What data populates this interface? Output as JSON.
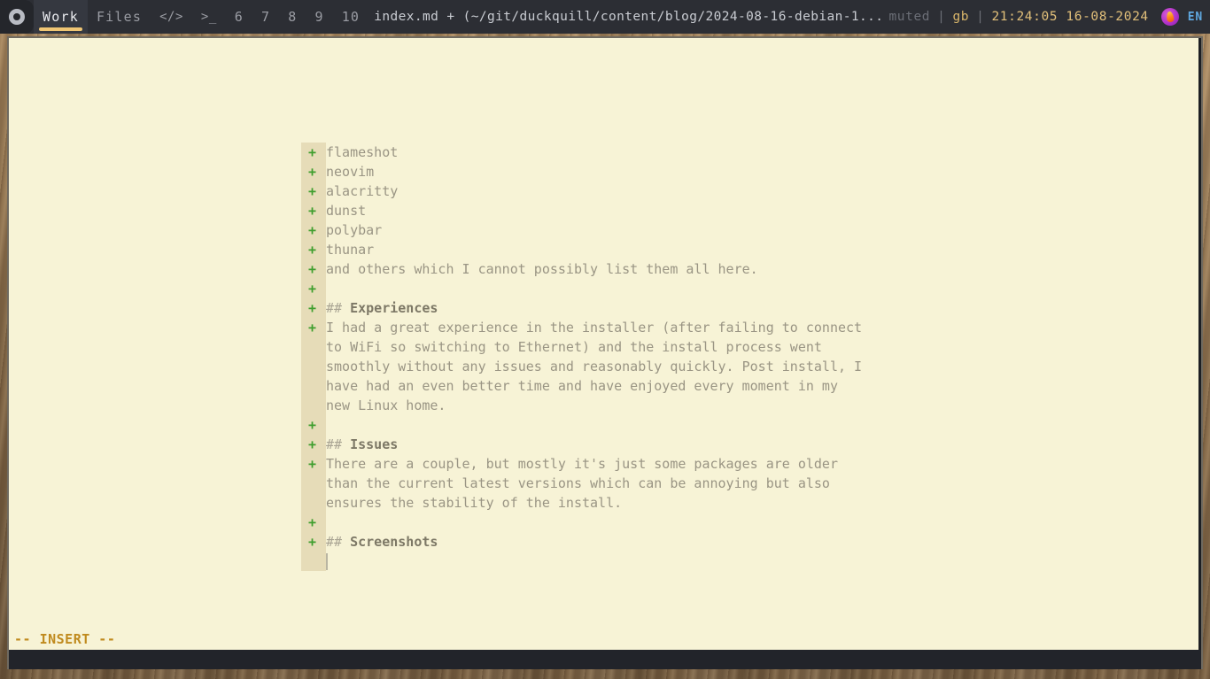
{
  "polybar": {
    "launcher_icon": "chromium-icon",
    "workspaces": [
      {
        "label": "Work",
        "active": true,
        "name": "workspace-work"
      },
      {
        "label": "Files",
        "active": false,
        "name": "workspace-files"
      },
      {
        "label": "</>",
        "active": false,
        "name": "workspace-code"
      },
      {
        "label": ">_",
        "active": false,
        "name": "workspace-terminal"
      },
      {
        "label": "6",
        "active": false,
        "name": "workspace-6"
      },
      {
        "label": "7",
        "active": false,
        "name": "workspace-7"
      },
      {
        "label": "8",
        "active": false,
        "name": "workspace-8"
      },
      {
        "label": "9",
        "active": false,
        "name": "workspace-9"
      },
      {
        "label": "10",
        "active": false,
        "name": "workspace-10"
      }
    ],
    "window_title": "index.md + (~/git/duckquill/content/blog/2024-08-16-debian-1...",
    "tray": {
      "volume": "muted",
      "separator": "|",
      "keyboard_layout": "gb",
      "clock": "21:24:05 16-08-2024",
      "notification_icon": "flame-circle-icon",
      "language": "EN"
    }
  },
  "editor": {
    "lines": [
      {
        "sign": "+",
        "text": "flameshot"
      },
      {
        "sign": "+",
        "text": "neovim"
      },
      {
        "sign": "+",
        "text": "alacritty"
      },
      {
        "sign": "+",
        "text": "dunst"
      },
      {
        "sign": "+",
        "text": "polybar"
      },
      {
        "sign": "+",
        "text": "thunar"
      },
      {
        "sign": "+",
        "text": "and others which I cannot possibly list them all here."
      },
      {
        "sign": "+",
        "text": ""
      },
      {
        "sign": "+",
        "text": "## Experiences",
        "heading": "Experiences",
        "marker": "## "
      },
      {
        "sign": "+",
        "text": "I had a great experience in the installer (after failing to connect"
      },
      {
        "sign": "",
        "text": "to WiFi so switching to Ethernet) and the install process went"
      },
      {
        "sign": "",
        "text": "smoothly without any issues and reasonably quickly. Post install, I"
      },
      {
        "sign": "",
        "text": "have had an even better time and have enjoyed every moment in my"
      },
      {
        "sign": "",
        "text": "new Linux home."
      },
      {
        "sign": "+",
        "text": ""
      },
      {
        "sign": "+",
        "text": "## Issues",
        "heading": "Issues",
        "marker": "## "
      },
      {
        "sign": "+",
        "text": "There are a couple, but mostly it's just some packages are older"
      },
      {
        "sign": "",
        "text": "than the current latest versions which can be annoying but also"
      },
      {
        "sign": "",
        "text": "ensures the stability of the install."
      },
      {
        "sign": "+",
        "text": ""
      },
      {
        "sign": "+",
        "text": "## Screenshots",
        "heading": "Screenshots",
        "marker": "## "
      },
      {
        "sign": "",
        "text": "",
        "cursor": true
      }
    ],
    "mode_label": "-- INSERT --"
  },
  "colors": {
    "bar_bg": "#2c2e34",
    "bar_accent": "#f0c674",
    "editor_bg": "#f7f3d6",
    "signcolumn_bg": "#e6dcb8",
    "diff_add": "#3f9e2e",
    "text_fg": "#9a9584",
    "heading_fg": "#7d7866",
    "mode_fg": "#c08a1e",
    "clock_fg": "#e2c07a",
    "lang_fg": "#5fa8e0"
  }
}
